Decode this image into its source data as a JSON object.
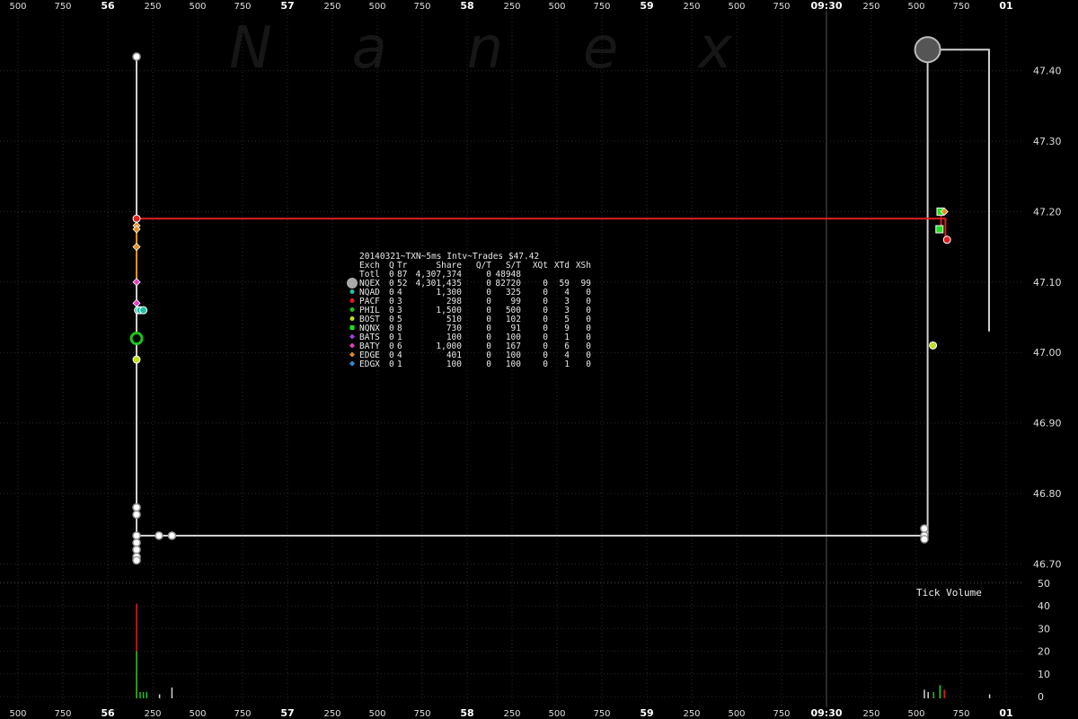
{
  "watermark": "N a n e x",
  "chart_data": {
    "type": "scatter",
    "title": "20140321~TXN~5ms Intv~Trades $47.42",
    "x_ticks_top": [
      "500",
      "750",
      "56",
      "250",
      "500",
      "750",
      "57",
      "250",
      "500",
      "750",
      "58",
      "250",
      "500",
      "750",
      "59",
      "250",
      "500",
      "750",
      "09:30",
      "250",
      "500",
      "750",
      "01"
    ],
    "x_ticks_bottom": [
      "500",
      "750",
      "56",
      "250",
      "500",
      "750",
      "57",
      "250",
      "500",
      "750",
      "58",
      "250",
      "500",
      "750",
      "59",
      "250",
      "500",
      "750",
      "09:30",
      "250",
      "500",
      "750",
      "01"
    ],
    "major_ticks": [
      "56",
      "57",
      "58",
      "59",
      "09:30",
      "01"
    ],
    "price_axis": {
      "ticks": [
        "47.40",
        "47.30",
        "47.20",
        "47.10",
        "47.00",
        "46.90",
        "46.80",
        "46.70"
      ],
      "ylim": [
        46.68,
        47.48
      ]
    },
    "volume_axis": {
      "label": "Tick Volume",
      "ticks": [
        "50",
        "40",
        "30",
        "20",
        "10",
        "0"
      ],
      "ylim": [
        0,
        50
      ]
    },
    "grid": true,
    "legend": {
      "header": [
        "Exch",
        "Q",
        "Tr",
        "Share",
        "Q/T",
        "S/T",
        "XQt",
        "XTd",
        "XSh"
      ],
      "rows": [
        {
          "exch": "Totl",
          "q": "0",
          "tr": "87",
          "share": "4,307,374",
          "qt": "0",
          "st": "48948",
          "xqt": "",
          "xtd": "",
          "xsh": "",
          "color": "",
          "marker": "none"
        },
        {
          "exch": "NQEX",
          "q": "0",
          "tr": "52",
          "share": "4,301,435",
          "qt": "0",
          "st": "82720",
          "xqt": "0",
          "xtd": "59",
          "xsh": "99",
          "color": "#b0b0b0",
          "marker": "big-circle"
        },
        {
          "exch": "NQAD",
          "q": "0",
          "tr": "4",
          "share": "1,300",
          "qt": "0",
          "st": "325",
          "xqt": "0",
          "xtd": "4",
          "xsh": "0",
          "color": "#20c0a0",
          "marker": "circle"
        },
        {
          "exch": "PACF",
          "q": "0",
          "tr": "3",
          "share": "298",
          "qt": "0",
          "st": "99",
          "xqt": "0",
          "xtd": "3",
          "xsh": "0",
          "color": "#e02020",
          "marker": "circle"
        },
        {
          "exch": "PHIL",
          "q": "0",
          "tr": "3",
          "share": "1,500",
          "qt": "0",
          "st": "500",
          "xqt": "0",
          "xtd": "3",
          "xsh": "0",
          "color": "#20c020",
          "marker": "circle"
        },
        {
          "exch": "BOST",
          "q": "0",
          "tr": "5",
          "share": "510",
          "qt": "0",
          "st": "102",
          "xqt": "0",
          "xtd": "5",
          "xsh": "0",
          "color": "#c0e020",
          "marker": "circle"
        },
        {
          "exch": "NQNX",
          "q": "0",
          "tr": "8",
          "share": "730",
          "qt": "0",
          "st": "91",
          "xqt": "0",
          "xtd": "9",
          "xsh": "0",
          "color": "#20e020",
          "marker": "square"
        },
        {
          "exch": "BATS",
          "q": "0",
          "tr": "1",
          "share": "100",
          "qt": "0",
          "st": "100",
          "xqt": "0",
          "xtd": "1",
          "xsh": "0",
          "color": "#a040e0",
          "marker": "diamond"
        },
        {
          "exch": "BATY",
          "q": "0",
          "tr": "6",
          "share": "1,000",
          "qt": "0",
          "st": "167",
          "xqt": "0",
          "xtd": "6",
          "xsh": "0",
          "color": "#e040c0",
          "marker": "diamond"
        },
        {
          "exch": "EDGE",
          "q": "0",
          "tr": "4",
          "share": "401",
          "qt": "0",
          "st": "100",
          "xqt": "0",
          "xtd": "4",
          "xsh": "0",
          "color": "#e09020",
          "marker": "diamond"
        },
        {
          "exch": "EDGX",
          "q": "0",
          "tr": "1",
          "share": "100",
          "qt": "0",
          "st": "100",
          "xqt": "0",
          "xtd": "1",
          "xsh": "0",
          "color": "#3090e0",
          "marker": "diamond"
        }
      ]
    },
    "series": [
      {
        "exch": "NQEX",
        "points": [
          {
            "t": 0.1267,
            "p": 47.42
          },
          {
            "t": 0.1267,
            "p": 46.78
          },
          {
            "t": 0.1267,
            "p": 46.77
          },
          {
            "t": 0.1267,
            "p": 46.74
          },
          {
            "t": 0.1267,
            "p": 46.73
          },
          {
            "t": 0.1267,
            "p": 46.72
          },
          {
            "t": 0.1267,
            "p": 46.71
          },
          {
            "t": 0.1267,
            "p": 46.705
          },
          {
            "t": 0.1475,
            "p": 46.74
          },
          {
            "t": 0.1595,
            "p": 46.74
          },
          {
            "t": 0.8575,
            "p": 46.75
          },
          {
            "t": 0.8575,
            "p": 46.74
          },
          {
            "t": 0.8575,
            "p": 46.735
          },
          {
            "t": 0.8605,
            "p": 47.43
          }
        ]
      },
      {
        "exch": "NQAD",
        "points": [
          {
            "t": 0.128,
            "p": 47.06
          },
          {
            "t": 0.13,
            "p": 47.06
          },
          {
            "t": 0.133,
            "p": 47.06
          }
        ]
      },
      {
        "exch": "PACF",
        "points": [
          {
            "t": 0.1267,
            "p": 47.19
          },
          {
            "t": 0.8785,
            "p": 47.16
          }
        ]
      },
      {
        "exch": "PHIL",
        "points": [
          {
            "t": 0.1267,
            "p": 47.02
          }
        ]
      },
      {
        "exch": "BOST",
        "points": [
          {
            "t": 0.1267,
            "p": 46.99
          },
          {
            "t": 0.8655,
            "p": 47.01
          }
        ]
      },
      {
        "exch": "NQNX",
        "points": [
          {
            "t": 0.8725,
            "p": 47.2
          },
          {
            "t": 0.8715,
            "p": 47.175
          }
        ]
      },
      {
        "exch": "BATY",
        "points": [
          {
            "t": 0.1267,
            "p": 47.1
          },
          {
            "t": 0.1267,
            "p": 47.07
          }
        ]
      },
      {
        "exch": "EDGE",
        "points": [
          {
            "t": 0.1267,
            "p": 47.18
          },
          {
            "t": 0.1267,
            "p": 47.175
          },
          {
            "t": 0.1267,
            "p": 47.15
          },
          {
            "t": 0.876,
            "p": 47.2
          }
        ]
      }
    ],
    "lines": [
      {
        "color": "#cfcfcf",
        "points": [
          {
            "t": 0.1267,
            "p": 47.42
          },
          {
            "t": 0.1267,
            "p": 46.74
          }
        ]
      },
      {
        "color": "#cfcfcf",
        "points": [
          {
            "t": 0.1267,
            "p": 46.74
          },
          {
            "t": 0.8575,
            "p": 46.74
          }
        ]
      },
      {
        "color": "#cfcfcf",
        "points": [
          {
            "t": 0.8605,
            "p": 47.43
          },
          {
            "t": 0.8605,
            "p": 46.74
          }
        ]
      },
      {
        "color": "#cfcfcf",
        "points": [
          {
            "t": 0.8605,
            "p": 47.43
          },
          {
            "t": 0.9175,
            "p": 47.43
          },
          {
            "t": 0.9175,
            "p": 47.03
          }
        ]
      },
      {
        "color": "#e02020",
        "points": [
          {
            "t": 0.1267,
            "p": 47.19
          },
          {
            "t": 0.877,
            "p": 47.19
          },
          {
            "t": 0.877,
            "p": 47.165
          },
          {
            "t": 0.8785,
            "p": 47.165
          }
        ]
      },
      {
        "color": "#e09020",
        "points": [
          {
            "t": 0.1267,
            "p": 47.18
          },
          {
            "t": 0.1267,
            "p": 47.1
          }
        ]
      },
      {
        "color": "#e02020",
        "points": [
          {
            "t": 0.873,
            "p": 47.2
          },
          {
            "t": 0.873,
            "p": 47.18
          }
        ]
      }
    ],
    "volume_bars": [
      {
        "t": 0.1267,
        "v": 41,
        "color": "#e02020"
      },
      {
        "t": 0.1267,
        "v": 20,
        "color": "#20c020"
      },
      {
        "t": 0.13,
        "v": 2,
        "color": "#20c020"
      },
      {
        "t": 0.133,
        "v": 2,
        "color": "#20c020"
      },
      {
        "t": 0.136,
        "v": 2,
        "color": "#20c020"
      },
      {
        "t": 0.148,
        "v": 1,
        "color": "#cfcfcf"
      },
      {
        "t": 0.1595,
        "v": 4,
        "color": "#cfcfcf"
      },
      {
        "t": 0.8575,
        "v": 3,
        "color": "#cfcfcf"
      },
      {
        "t": 0.861,
        "v": 2,
        "color": "#cfcfcf"
      },
      {
        "t": 0.866,
        "v": 2,
        "color": "#20c020"
      },
      {
        "t": 0.872,
        "v": 5,
        "color": "#20e020"
      },
      {
        "t": 0.876,
        "v": 3,
        "color": "#e02020"
      },
      {
        "t": 0.918,
        "v": 1,
        "color": "#cfcfcf"
      }
    ]
  }
}
